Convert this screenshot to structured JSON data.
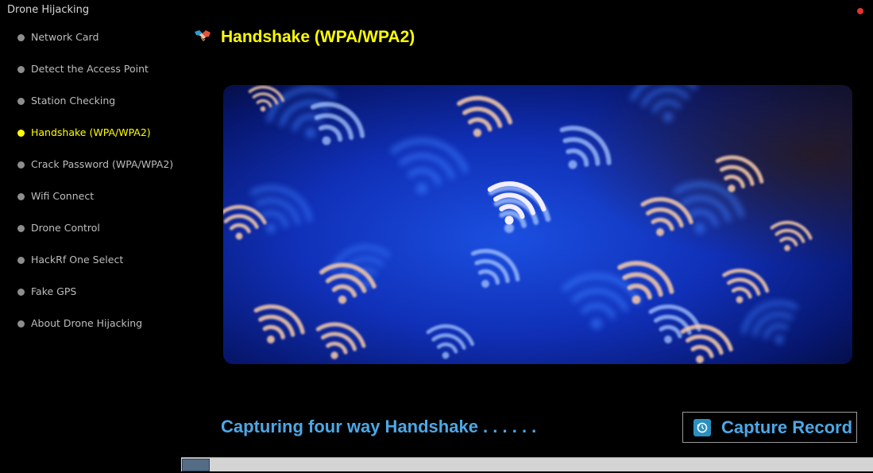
{
  "window": {
    "title": "Drone Hijacking"
  },
  "sidebar": {
    "items": [
      {
        "label": "Network Card",
        "active": false
      },
      {
        "label": "Detect the Access Point",
        "active": false
      },
      {
        "label": "Station Checking",
        "active": false
      },
      {
        "label": "Handshake (WPA/WPA2)",
        "active": true
      },
      {
        "label": "Crack Password (WPA/WPA2)",
        "active": false
      },
      {
        "label": "Wifi Connect",
        "active": false
      },
      {
        "label": "Drone Control",
        "active": false
      },
      {
        "label": "HackRf One Select",
        "active": false
      },
      {
        "label": "Fake GPS",
        "active": false
      },
      {
        "label": "About Drone Hijacking",
        "active": false
      }
    ]
  },
  "main": {
    "title": "Handshake (WPA/WPA2)",
    "header_icon": "handshake-icon",
    "hero_image": "wifi-signals-illustration",
    "status_text": "Capturing four way Handshake . . . . . .",
    "capture_button": {
      "label": "Capture Record",
      "icon": "record-icon"
    },
    "progress": {
      "value_percent": 4
    }
  },
  "colors": {
    "accent_yellow": "#ffff00",
    "accent_blue": "#4ba8e6",
    "button_icon_bg": "#2b8fc0",
    "background": "#000000",
    "progress_fill": "#556c85"
  }
}
